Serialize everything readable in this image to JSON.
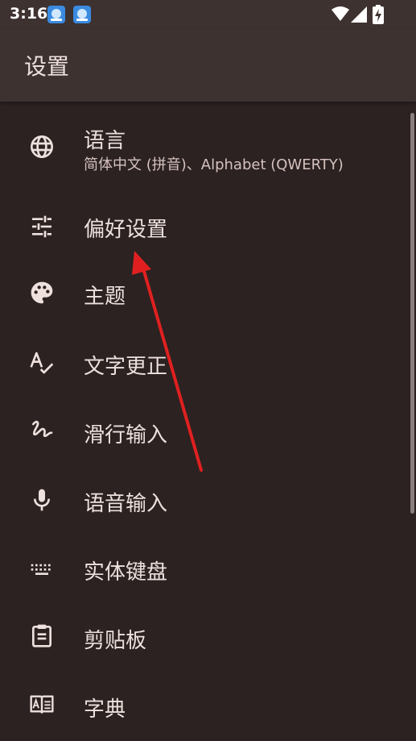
{
  "status_bar": {
    "time": "3:16",
    "icons": [
      "app-notification-icon",
      "app-notification-icon",
      "wifi-icon",
      "cell-signal-icon",
      "battery-charging-icon"
    ]
  },
  "app_bar": {
    "title": "设置"
  },
  "settings": {
    "items": [
      {
        "title": "语言",
        "subtitle": "简体中文 (拼音)、Alphabet (QWERTY)",
        "icon": "globe-icon"
      },
      {
        "title": "偏好设置",
        "icon": "tune-icon"
      },
      {
        "title": "主题",
        "icon": "palette-icon"
      },
      {
        "title": "文字更正",
        "icon": "spellcheck-icon"
      },
      {
        "title": "滑行输入",
        "icon": "gesture-icon"
      },
      {
        "title": "语音输入",
        "icon": "mic-icon"
      },
      {
        "title": "实体键盘",
        "icon": "keyboard-icon"
      },
      {
        "title": "剪贴板",
        "icon": "clipboard-icon"
      },
      {
        "title": "字典",
        "icon": "dictionary-icon"
      }
    ]
  },
  "colors": {
    "background": "#2b2221",
    "app_bar": "#3e3231",
    "text": "#ede0dd",
    "annotation": "#e02020"
  }
}
